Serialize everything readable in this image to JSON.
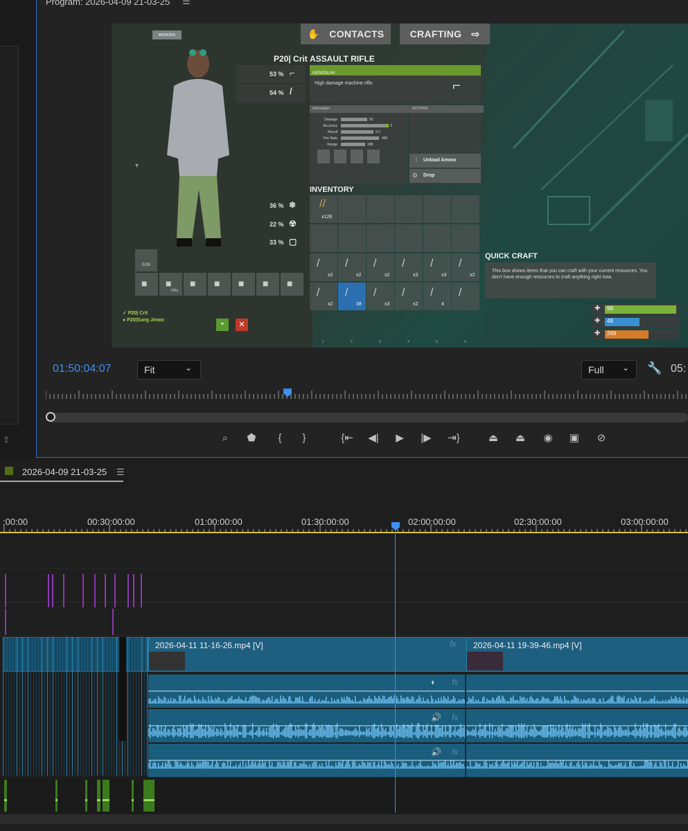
{
  "monitor": {
    "title": "Program: 2026-04-09 21-03-25",
    "timecode": "01:50:04:07",
    "fit_label": "Fit",
    "quality_label": "Full",
    "end_timecode_partial": "05:"
  },
  "game": {
    "missions_label": "MISSIONS",
    "contacts_label": "CONTACTS",
    "crafting_label": "CRAFTING",
    "player_name": "P20| Crit",
    "item_title": "ASSAULT RIFLE",
    "item_subtitle": "GENOSLAV",
    "item_desc": "High damage machine rifle.",
    "info_header": "Information",
    "actions_header": "ACTIONS",
    "stats": [
      {
        "label": "Damage",
        "value": "50"
      },
      {
        "label": "Accuracy",
        "value": "3"
      },
      {
        "label": "Recoil",
        "value": "6.0"
      },
      {
        "label": "Fire Rate",
        "value": "450"
      },
      {
        "label": "Range",
        "value": "188"
      }
    ],
    "unload_label": "Unload Ammo",
    "drop_label": "Drop",
    "inventory_label": "INVENTORY",
    "ammo_count": "x128",
    "protection": {
      "top1": "53 %",
      "top2": "54 %",
      "cold": "36 %",
      "rad": "22 %",
      "melee": "33 %"
    },
    "wear_slot_count": "0/28",
    "helmet_hp": "720s",
    "team": [
      "P20| Crit",
      "P20|Sung Jinwo"
    ],
    "quick_craft_title": "QUICK CRAFT",
    "quick_craft_text": "This box shows items that you can craft with your current resources. You don't have enough resources to craft anything right now.",
    "vitals": [
      {
        "icon": "health-icon",
        "value": "98",
        "color": "#7bb33a",
        "fill": 0.98
      },
      {
        "icon": "food-icon",
        "value": "48",
        "color": "#3a8fd0",
        "fill": 0.48
      },
      {
        "icon": "water-icon",
        "value": "269",
        "color": "#d47b2a",
        "fill": 0.6
      }
    ],
    "inv_counts": [
      "x2",
      "x2",
      "x2",
      "x3",
      "x3",
      "x2"
    ],
    "belt_counts": [
      "x2",
      "38",
      "x3",
      "x2",
      "4",
      ""
    ],
    "belt_nums": [
      "1",
      "2",
      "3",
      "4",
      "5",
      "6"
    ]
  },
  "timeline": {
    "sequence_name": "2026-04-09 21-03-25",
    "ruler": [
      ":00:00",
      "00:30:00:00",
      "01:00:00:00",
      "01:30:00:00",
      "02:00:00:00",
      "02:30:00:00",
      "03:00:00:00"
    ],
    "clips": [
      {
        "name": "2026-04-11 11-16-26.mp4 [V]"
      },
      {
        "name": "2026-04-11 19-39-46.mp4 [V]"
      }
    ],
    "fx_label": "fx"
  },
  "colors": {
    "accent": "#2d6fd0",
    "clip": "#1e5f80",
    "playhead": "#3d8ff0",
    "green": "#7bb33a"
  }
}
